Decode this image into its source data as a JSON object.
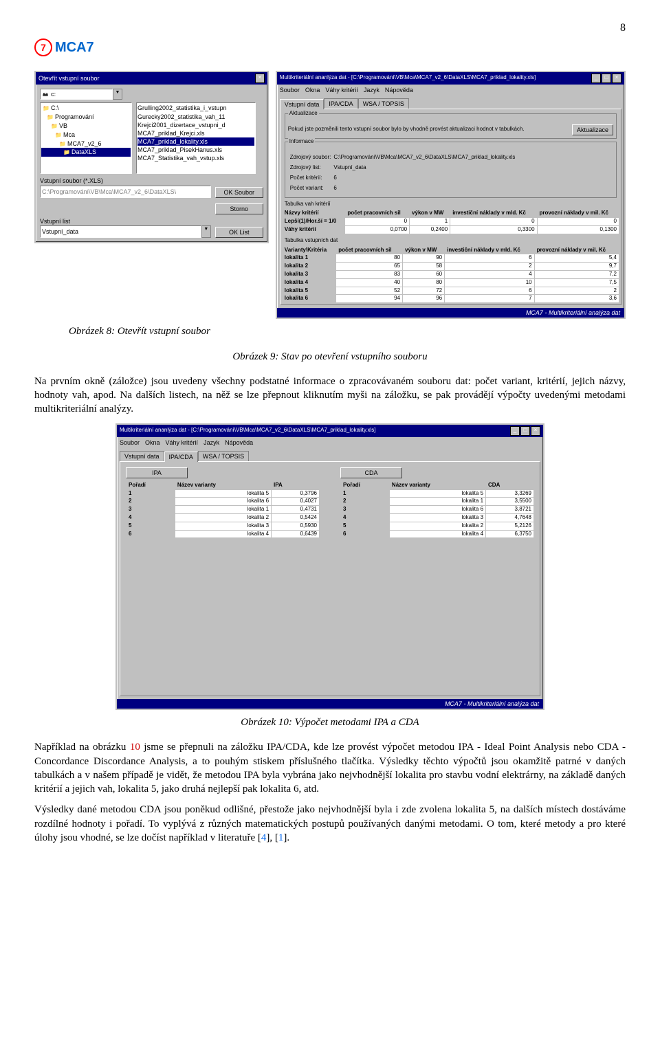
{
  "page_number": "8",
  "logo_text": "MCA7",
  "caption_fig8": "Obrázek 8: Otevřít vstupní soubor",
  "caption_fig9": "Obrázek 9: Stav po otevření vstupního souboru",
  "caption_fig10": "Obrázek 10: Výpočet metodami IPA a CDA",
  "para1": "Na prvním okně (záložce) jsou uvedeny všechny podstatné informace o zpracovávaném souboru dat: počet variant, kritérií, jejich názvy, hodnoty vah, apod. Na dalších listech, na něž se lze přepnout kliknutím myši na záložku, se pak provádějí výpočty uvedenými metodami multikriteriální analýzy.",
  "para2_a": "Například na obrázku ",
  "para2_ref": "10",
  "para2_b": " jsme se přepnuli na záložku IPA/CDA, kde lze provést výpočet metodou IPA - Ideal Point Analysis nebo CDA - Concordance Discordance Analysis, a to pouhým stiskem příslušného tlačítka. Výsledky těchto výpočtů jsou okamžitě patrné v daných tabulkách a v našem případě je vidět, že metodou IPA byla vybrána jako nejvhodnější lokalita pro stavbu vodní elektrárny, na základě daných kritérií a jejich vah, lokalita 5, jako druhá nejlepší pak lokalita 6, atd.",
  "para3_a": "Výsledky dané metodou CDA jsou poněkud odlišné, přestože jako nejvhodnější byla i zde zvolena lokalita 5, na dalších místech dostáváme rozdílné hodnoty i pořadí. To vyplývá z různých matematických postupů používaných danými metodami. O tom, které metody a pro které úlohy jsou vhodné, se lze dočíst například v literatuře [",
  "para3_ref1": "4",
  "para3_mid": "], [",
  "para3_ref2": "1",
  "para3_end": "].",
  "dlg_open": {
    "title": "Otevřít vstupní soubor",
    "drive": "c:",
    "dirs": [
      "C:\\",
      "Programování",
      "VB",
      "Mca",
      "MCA7_v2_6",
      "DataXLS"
    ],
    "dir_selected_index": 5,
    "files": [
      "Grulling2002_statistika_i_vstupn",
      "Gurecky2002_statistika_vah_11",
      "Krejci2001_dizertace_vstupni_d",
      "MCA7_priklad_Krejci.xls",
      "MCA7_priklad_lokality.xls",
      "MCA7_priklad_PisekHanus.xls",
      "MCA7_Statistika_vah_vstup.xls"
    ],
    "file_selected_index": 4,
    "lbl_vstupni_soubor": "Vstupní soubor (*.XLS)",
    "path_value": "C:\\Programování\\VB\\Mca\\MCA7_v2_6\\DataXLS\\",
    "lbl_vstupni_list": "Vstupní list",
    "list_value": "Vstupní_data",
    "btn_ok_soubor": "OK Soubor",
    "btn_storno": "Storno",
    "btn_ok_list": "OK List"
  },
  "win_main": {
    "title": "Multikriteriální ananlýza dat - [C:\\Programování\\VB\\Mca\\MCA7_v2_6\\DataXLS\\MCA7_priklad_lokality.xls]",
    "menu": [
      "Soubor",
      "Okna",
      "Váhy kritérií",
      "Jazyk",
      "Nápověda"
    ],
    "tabs": [
      "Vstupní data",
      "IPA/CDA",
      "WSA / TOPSIS"
    ],
    "active_tab": 0,
    "grp_aktual_title": "Aktualizace",
    "grp_aktual_text": "Pokud jste pozměnili tento vstupní soubor bylo by vhodně provést aktualizaci hodnot v tabulkách.",
    "btn_aktual": "Aktualizace",
    "grp_info_title": "Informace",
    "info_rows": [
      [
        "Zdrojový soubor:",
        "C:\\Programování\\VB\\Mca\\MCA7_v2_6\\DataXLS\\MCA7_priklad_lokality.xls"
      ],
      [
        "Zdrojový list:",
        "Vstupní_data"
      ],
      [
        "Počet kritérií:",
        "6"
      ],
      [
        "Počet variant:",
        "6"
      ]
    ],
    "tbl_weights_caption": "Tabulka vah kritérií",
    "tbl_weights_header": [
      "Názvy kritérií",
      "počet pracovních sil",
      "výkon v MW",
      "investiční náklady v mld. Kč",
      "provozní náklady v mil. Kč"
    ],
    "tbl_weights_r1": [
      "Lepší(1)/Hor.ší = 1/0",
      "0",
      "1",
      "0",
      "0"
    ],
    "tbl_weights_r2": [
      "Váhy kritérií",
      "0,0700",
      "0,2400",
      "0,3300",
      "0,1300"
    ],
    "tbl_data_caption": "Tabulka vstupních dat",
    "tbl_data_header": [
      "Varianty\\Kritéria",
      "počet pracovních sil",
      "výkon v MW",
      "investiční náklady v mld. Kč",
      "provozní náklady v mil. Kč"
    ],
    "tbl_data_rows": [
      [
        "lokalita 1",
        "80",
        "90",
        "6",
        "5,4"
      ],
      [
        "lokalita 2",
        "65",
        "58",
        "2",
        "9,7"
      ],
      [
        "lokalita 3",
        "83",
        "60",
        "4",
        "7,2"
      ],
      [
        "lokalita 4",
        "40",
        "80",
        "10",
        "7,5"
      ],
      [
        "lokalita 5",
        "52",
        "72",
        "6",
        "2"
      ],
      [
        "lokalita 6",
        "94",
        "96",
        "7",
        "3,6"
      ]
    ],
    "statusbar": "MCA7 - Multikriteriální analýza dat"
  },
  "win_calc": {
    "title": "Multikriteriální ananlýza dat - [C:\\Programování\\VB\\Mca\\MCA7_v2_6\\DataXLS\\MCA7_priklad_lokality.xls]",
    "menu": [
      "Soubor",
      "Okna",
      "Váhy kritérií",
      "Jazyk",
      "Nápověda"
    ],
    "tabs": [
      "Vstupní data",
      "IPA/CDA",
      "WSA / TOPSIS"
    ],
    "active_tab": 1,
    "btn_ipa": "IPA",
    "btn_cda": "CDA",
    "ipa_header": [
      "Pořadí",
      "Název varianty",
      "IPA"
    ],
    "ipa_rows": [
      [
        "1",
        "lokalita 5",
        "0,3796"
      ],
      [
        "2",
        "lokalita 6",
        "0,4027"
      ],
      [
        "3",
        "lokalita 1",
        "0,4731"
      ],
      [
        "4",
        "lokalita 2",
        "0,5424"
      ],
      [
        "5",
        "lokalita 3",
        "0,5930"
      ],
      [
        "6",
        "lokalita 4",
        "0,6439"
      ]
    ],
    "cda_header": [
      "Pořadí",
      "Název varianty",
      "CDA"
    ],
    "cda_rows": [
      [
        "1",
        "lokalita 5",
        "3,3269"
      ],
      [
        "2",
        "lokalita 1",
        "3,5500"
      ],
      [
        "3",
        "lokalita 6",
        "3,8721"
      ],
      [
        "4",
        "lokalita 3",
        "4,7648"
      ],
      [
        "5",
        "lokalita 2",
        "5,2126"
      ],
      [
        "6",
        "lokalita 4",
        "6,3750"
      ]
    ],
    "statusbar": "MCA7 - Multikriteriální analýza dat"
  }
}
